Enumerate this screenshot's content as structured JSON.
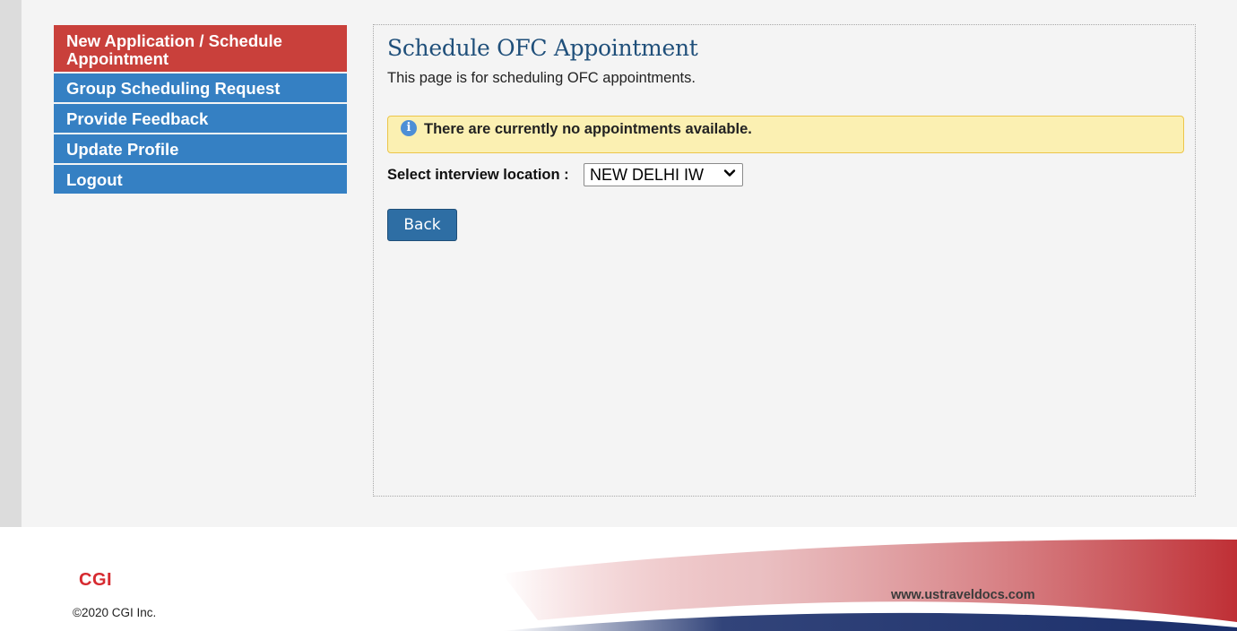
{
  "sidebar": {
    "items": [
      {
        "label": "New Application / Schedule Appointment",
        "active": true
      },
      {
        "label": "Group Scheduling Request",
        "active": false
      },
      {
        "label": "Provide Feedback",
        "active": false
      },
      {
        "label": "Update Profile",
        "active": false
      },
      {
        "label": "Logout",
        "active": false
      }
    ]
  },
  "main": {
    "title": "Schedule OFC Appointment",
    "description": "This page is for scheduling OFC appointments.",
    "alert": {
      "icon": "info-icon",
      "text": "There are currently no appointments available."
    },
    "location": {
      "label": "Select interview location :",
      "selected": "NEW DELHI IW"
    },
    "back_label": "Back"
  },
  "footer": {
    "logo": "CGI",
    "copyright": "©2020 CGI Inc.",
    "site": "www.ustraveldocs.com"
  },
  "colors": {
    "active_nav": "#c9403b",
    "nav": "#3580c3",
    "title": "#1f4f7a",
    "alert_bg": "#fbf0b2",
    "button": "#2e6ea4",
    "logo_red": "#d62a30"
  }
}
